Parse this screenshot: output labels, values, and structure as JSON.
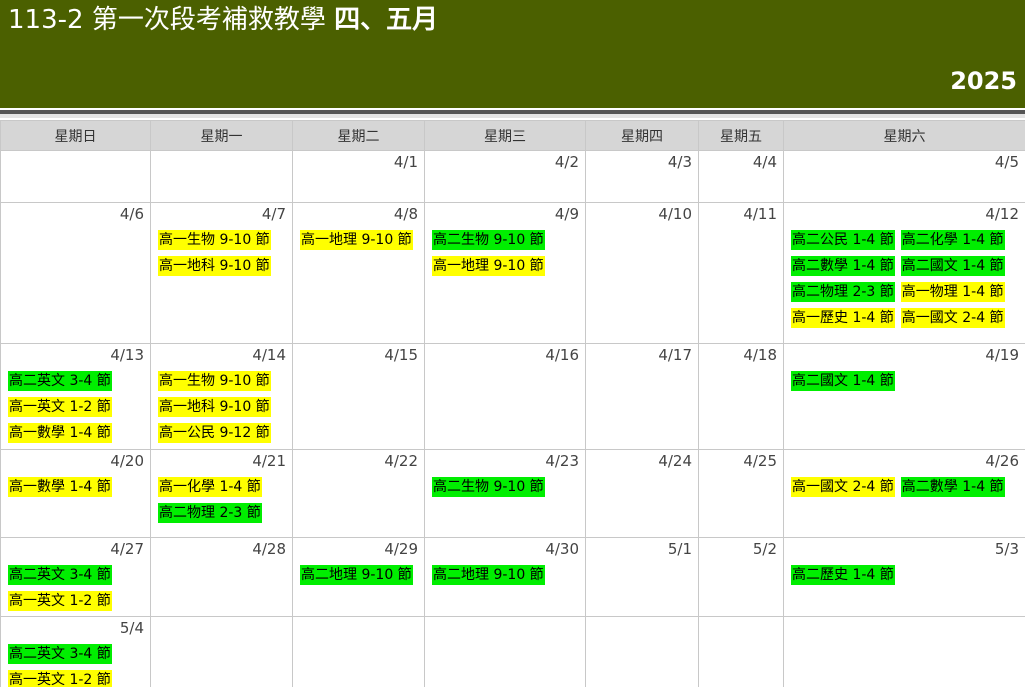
{
  "header": {
    "title_main": "113-2 第一次段考補救教學",
    "title_months": "四、五月",
    "year": "2025"
  },
  "colors": {
    "header_bg": "#4b6000",
    "yellow": "#ffff00",
    "green": "#00ee00"
  },
  "weekdays": [
    "星期日",
    "星期一",
    "星期二",
    "星期三",
    "星期四",
    "星期五",
    "星期六"
  ],
  "weeks": [
    [
      {
        "date": "",
        "events": []
      },
      {
        "date": "",
        "events": []
      },
      {
        "date": "4/1",
        "events": []
      },
      {
        "date": "4/2",
        "events": []
      },
      {
        "date": "4/3",
        "events": []
      },
      {
        "date": "4/4",
        "events": []
      },
      {
        "date": "4/5",
        "events": []
      }
    ],
    [
      {
        "date": "4/6",
        "events": []
      },
      {
        "date": "4/7",
        "events": [
          {
            "label": "高一生物 9-10 節",
            "color": "yellow"
          },
          {
            "label": "高一地科 9-10 節",
            "color": "yellow"
          }
        ]
      },
      {
        "date": "4/8",
        "events": [
          {
            "label": "高一地理 9-10 節",
            "color": "yellow"
          }
        ]
      },
      {
        "date": "4/9",
        "events": [
          {
            "label": "高二生物 9-10 節",
            "color": "green"
          },
          {
            "label": "高一地理 9-10 節",
            "color": "yellow"
          }
        ]
      },
      {
        "date": "4/10",
        "events": []
      },
      {
        "date": "4/11",
        "events": []
      },
      {
        "date": "4/12",
        "events": [
          {
            "label": "高二公民 1-4 節",
            "color": "green"
          },
          {
            "label": "高二化學 1-4 節",
            "color": "green"
          },
          {
            "label": "高二數學 1-4 節",
            "color": "green"
          },
          {
            "label": "高二國文 1-4 節",
            "color": "green"
          },
          {
            "label": "高二物理 2-3 節",
            "color": "green"
          },
          {
            "label": "高一物理 1-4 節",
            "color": "yellow"
          },
          {
            "label": "高一歷史 1-4 節",
            "color": "yellow"
          },
          {
            "label": "高一國文 2-4 節",
            "color": "yellow"
          }
        ]
      }
    ],
    [
      {
        "date": "4/13",
        "events": [
          {
            "label": "高二英文 3-4 節",
            "color": "green"
          },
          {
            "label": "高一英文 1-2 節",
            "color": "yellow"
          },
          {
            "label": "高一數學 1-4 節",
            "color": "yellow"
          }
        ]
      },
      {
        "date": "4/14",
        "events": [
          {
            "label": "高一生物 9-10 節",
            "color": "yellow"
          },
          {
            "label": "高一地科 9-10 節",
            "color": "yellow"
          },
          {
            "label": "高一公民 9-12 節",
            "color": "yellow"
          }
        ]
      },
      {
        "date": "4/15",
        "events": []
      },
      {
        "date": "4/16",
        "events": []
      },
      {
        "date": "4/17",
        "events": []
      },
      {
        "date": "4/18",
        "events": []
      },
      {
        "date": "4/19",
        "events": [
          {
            "label": "高二國文 1-4 節",
            "color": "green"
          }
        ]
      }
    ],
    [
      {
        "date": "4/20",
        "events": [
          {
            "label": "高一數學 1-4 節",
            "color": "yellow"
          }
        ]
      },
      {
        "date": "4/21",
        "events": [
          {
            "label": "高一化學 1-4 節",
            "color": "yellow"
          },
          {
            "label": "高二物理 2-3 節",
            "color": "green"
          }
        ]
      },
      {
        "date": "4/22",
        "events": []
      },
      {
        "date": "4/23",
        "events": [
          {
            "label": "高二生物 9-10 節",
            "color": "green"
          }
        ]
      },
      {
        "date": "4/24",
        "events": []
      },
      {
        "date": "4/25",
        "events": []
      },
      {
        "date": "4/26",
        "events": [
          {
            "label": "高一國文 2-4 節",
            "color": "yellow"
          },
          {
            "label": "高二數學 1-4 節",
            "color": "green"
          }
        ]
      }
    ],
    [
      {
        "date": "4/27",
        "events": [
          {
            "label": "高二英文 3-4 節",
            "color": "green"
          },
          {
            "label": "高一英文 1-2 節",
            "color": "yellow"
          }
        ]
      },
      {
        "date": "4/28",
        "events": []
      },
      {
        "date": "4/29",
        "events": [
          {
            "label": "高二地理 9-10 節",
            "color": "green"
          }
        ]
      },
      {
        "date": "4/30",
        "events": [
          {
            "label": "高二地理 9-10 節",
            "color": "green"
          }
        ]
      },
      {
        "date": "5/1",
        "events": []
      },
      {
        "date": "5/2",
        "events": []
      },
      {
        "date": "5/3",
        "events": [
          {
            "label": "高二歷史 1-4 節",
            "color": "green"
          }
        ]
      }
    ],
    [
      {
        "date": "5/4",
        "events": [
          {
            "label": "高二英文 3-4 節",
            "color": "green"
          },
          {
            "label": "高一英文 1-2 節",
            "color": "yellow"
          }
        ]
      },
      {
        "date": "",
        "events": []
      },
      {
        "date": "",
        "events": []
      },
      {
        "date": "",
        "events": []
      },
      {
        "date": "",
        "events": []
      },
      {
        "date": "",
        "events": []
      },
      {
        "date": "",
        "events": []
      }
    ]
  ]
}
